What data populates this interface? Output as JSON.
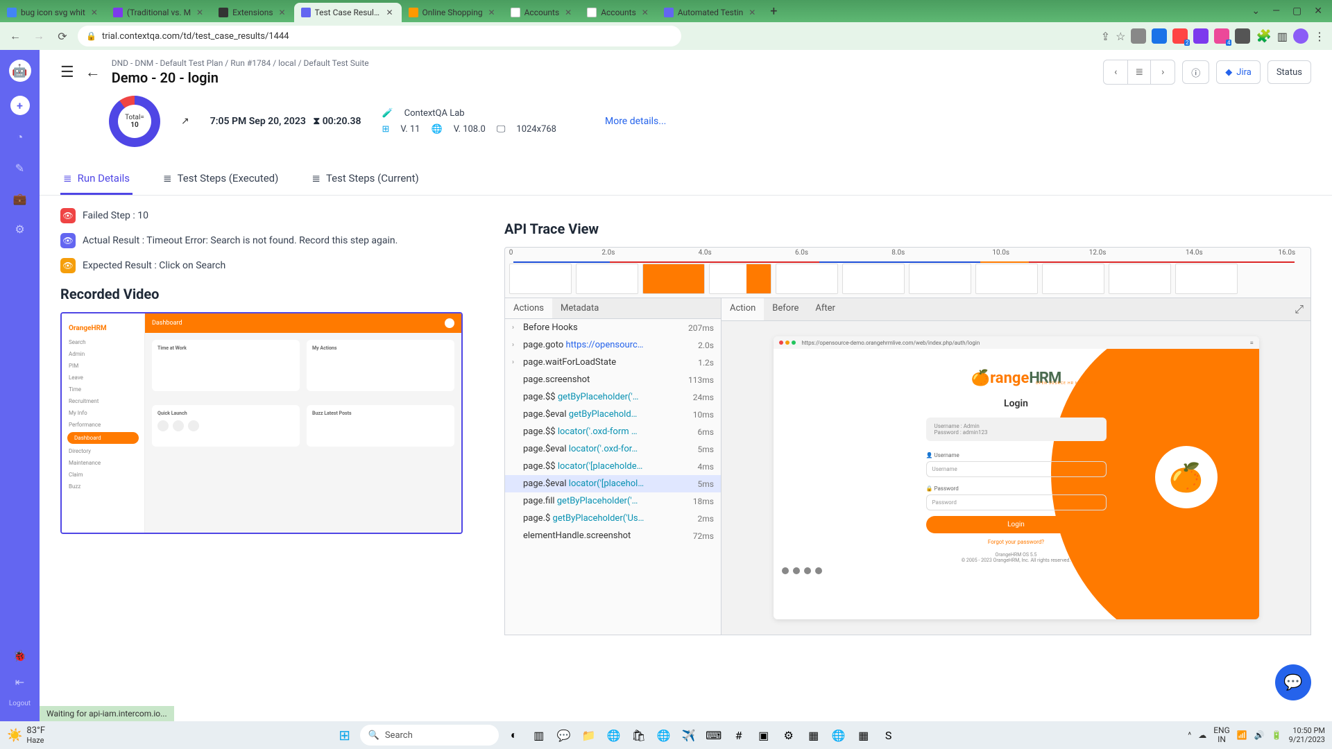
{
  "browser": {
    "tabs": [
      {
        "label": "bug icon svg whit"
      },
      {
        "label": "(Traditional vs. M"
      },
      {
        "label": "Extensions"
      },
      {
        "label": "Test Case Result D",
        "active": true
      },
      {
        "label": "Online Shopping"
      },
      {
        "label": "Accounts"
      },
      {
        "label": "Accounts"
      },
      {
        "label": "Automated Testin"
      }
    ],
    "url": "trial.contextqa.com/td/test_case_results/1444"
  },
  "breadcrumb": [
    "DND - DNM - Default Test Plan",
    "Run #1784",
    "local",
    "Default Test Suite"
  ],
  "page_title": "Demo - 20 - login",
  "header_buttons": {
    "jira": "Jira",
    "status": "Status"
  },
  "summary": {
    "donut": {
      "label": "Total=",
      "value": "10"
    },
    "timestamp": "7:05 PM Sep 20, 2023",
    "duration": "00:20.38",
    "lab": "ContextQA Lab",
    "win_ver": "V. 11",
    "chrome_ver": "V. 108.0",
    "resolution": "1024x768",
    "more": "More details..."
  },
  "content_tabs": [
    "Run Details",
    "Test Steps (Executed)",
    "Test Steps (Current)"
  ],
  "left": {
    "failed": "Failed Step : 10",
    "actual": "Actual Result : Timeout Error: Search is not found. Record this step again.",
    "expected": "Expected Result : Click on Search",
    "recorded_title": "Recorded Video"
  },
  "api_title": "API Trace View",
  "timeline_ticks": [
    "0",
    "2.0s",
    "4.0s",
    "6.0s",
    "8.0s",
    "10.0s",
    "12.0s",
    "14.0s",
    "16.0s"
  ],
  "panel_tabs_left": [
    "Actions",
    "Metadata"
  ],
  "panel_tabs_right": [
    "Action",
    "Before",
    "After"
  ],
  "actions": [
    {
      "caret": "›",
      "name": "Before Hooks",
      "time": "207ms"
    },
    {
      "caret": "›",
      "name": "page.goto",
      "locator": "https://opensourc…",
      "locatorClass": "url",
      "time": "2.0s"
    },
    {
      "caret": "›",
      "name": "page.waitForLoadState",
      "time": "1.2s"
    },
    {
      "caret": "",
      "name": "page.screenshot",
      "time": "113ms"
    },
    {
      "caret": "",
      "name": "page.$$",
      "locator": "getByPlaceholder('…",
      "time": "24ms"
    },
    {
      "caret": "",
      "name": "page.$eval",
      "locator": "getByPlacehold…",
      "time": "10ms"
    },
    {
      "caret": "",
      "name": "page.$$",
      "locator": "locator('.oxd-form …",
      "time": "6ms"
    },
    {
      "caret": "",
      "name": "page.$eval",
      "locator": "locator('.oxd-for…",
      "time": "5ms"
    },
    {
      "caret": "",
      "name": "page.$$",
      "locator": "locator('[placeholde…",
      "time": "4ms"
    },
    {
      "caret": "",
      "name": "page.$eval",
      "locator": "locator('[placehol…",
      "time": "5ms",
      "selected": true
    },
    {
      "caret": "",
      "name": "page.fill",
      "locator": "getByPlaceholder('…",
      "time": "18ms"
    },
    {
      "caret": "",
      "name": "page.$",
      "locator": "getByPlaceholder('Us…",
      "time": "2ms"
    },
    {
      "caret": "",
      "name": "elementHandle.screenshot",
      "time": "72ms"
    }
  ],
  "ohrm": {
    "url": "https://opensource-demo.orangehrmlive.com/web/index.php/auth/login",
    "logo_o": "🍊range",
    "logo_rest": "HRM",
    "logo_sub": "OPEN SOURCE HR MANAGEMENT",
    "login": "Login",
    "cred1": "Username : Admin",
    "cred2": "Password : admin123",
    "user_label": "Username",
    "user_ph": "Username",
    "pass_label": "Password",
    "pass_ph": "Password",
    "btn": "Login",
    "forgot": "Forgot your password?",
    "footer1": "OrangeHRM OS 5.5",
    "footer2": "© 2005 - 2023 OrangeHRM, Inc. All rights reserved."
  },
  "video_mock": {
    "logo": "OrangeHRM",
    "header": "Dashboard",
    "side": [
      "Search",
      "Admin",
      "PIM",
      "Leave",
      "Time",
      "Recruitment",
      "My Info",
      "Performance",
      "Dashboard",
      "Directory",
      "Maintenance",
      "Claim",
      "Buzz"
    ],
    "card1": "Time at Work",
    "card2": "My Actions",
    "card3": "Quick Launch",
    "card4": "Buzz Latest Posts"
  },
  "sidebar": {
    "logout": "Logout"
  },
  "status_bar": "Waiting for api-iam.intercom.io...",
  "taskbar": {
    "temp": "83°F",
    "weather": "Haze",
    "search": "Search",
    "lang1": "ENG",
    "lang2": "IN",
    "time": "10:50 PM",
    "date": "9/21/2023"
  }
}
